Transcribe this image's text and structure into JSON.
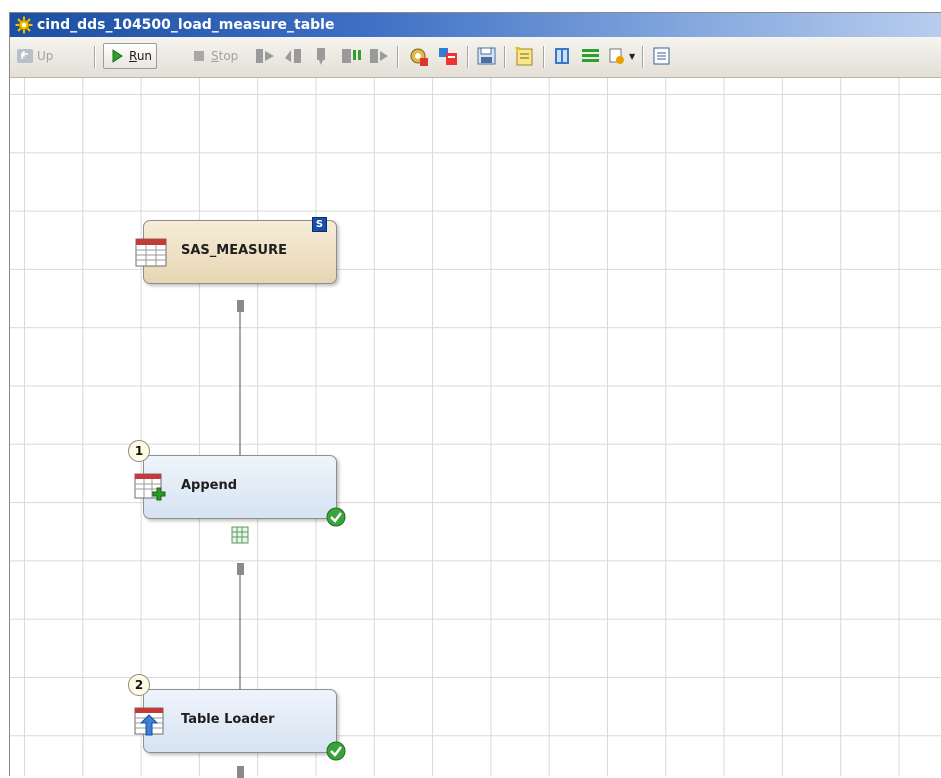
{
  "window": {
    "title": "cind_dds_104500_load_measure_table",
    "title_icon": "job-gear-icon"
  },
  "toolbar": {
    "up_label": "Up",
    "run_label": "Run",
    "stop_label": "Stop",
    "icons": [
      "run-from-selected-icon",
      "step-icon",
      "continue-icon",
      "pause-icon",
      "run-to-icon",
      "properties-icon",
      "debug-icon",
      "save-icon",
      "notes-icon",
      "details-icon",
      "split-icon",
      "add-transform-icon",
      "layout-icon"
    ]
  },
  "diagram": {
    "nodes": [
      {
        "id": "sas-measure",
        "label": "SAS_MEASURE",
        "kind": "table",
        "badge": "S",
        "icon": "table-icon"
      },
      {
        "id": "append",
        "label": "Append",
        "kind": "transform",
        "step": "1",
        "icon": "append-table-icon",
        "status": "success"
      },
      {
        "id": "table-loader",
        "label": "Table Loader",
        "kind": "transform",
        "step": "2",
        "icon": "table-loader-icon",
        "status": "success"
      }
    ],
    "connections": [
      {
        "from": "sas-measure",
        "to": "append"
      },
      {
        "from": "append",
        "to": "table-loader"
      }
    ],
    "work_table_icon": "work-table-icon"
  }
}
